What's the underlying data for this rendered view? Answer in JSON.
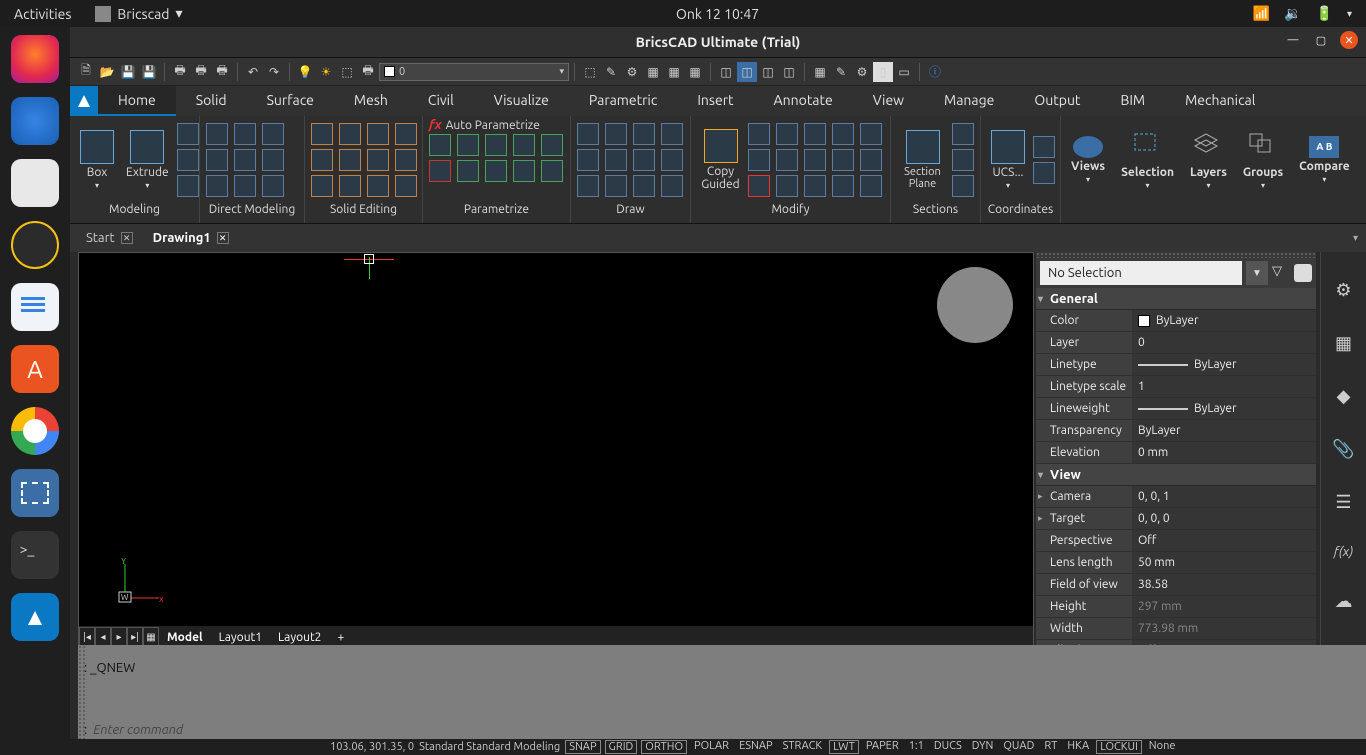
{
  "topbar": {
    "activities": "Activities",
    "app": "Bricscad",
    "datetime": "Onk 12  10:47"
  },
  "window": {
    "title": "BricsCAD Ultimate (Trial)"
  },
  "layer_combo": "0",
  "ribbon": {
    "tabs": [
      "Home",
      "Solid",
      "Surface",
      "Mesh",
      "Civil",
      "Visualize",
      "Parametric",
      "Insert",
      "Annotate",
      "View",
      "Manage",
      "Output",
      "BIM",
      "Mechanical"
    ],
    "active": "Home",
    "modeling": {
      "box": "Box",
      "extrude": "Extrude",
      "title": "Modeling"
    },
    "direct": {
      "title": "Direct Modeling"
    },
    "solidedit": {
      "title": "Solid Editing"
    },
    "parametrize": {
      "auto": "Auto Parametrize",
      "title": "Parametrize"
    },
    "draw": {
      "title": "Draw"
    },
    "modify": {
      "copy": "Copy Guided",
      "title": "Modify"
    },
    "sections": {
      "section": "Section Plane",
      "title": "Sections"
    },
    "coords": {
      "ucs": "UCS...",
      "title": "Coordinates"
    },
    "right": {
      "views": "Views",
      "selection": "Selection",
      "layers": "Layers",
      "groups": "Groups",
      "compare": "Compare"
    }
  },
  "doctabs": {
    "start": "Start",
    "drawing": "Drawing1"
  },
  "layout": {
    "model": "Model",
    "l1": "Layout1",
    "l2": "Layout2"
  },
  "cmd": {
    "hist": ":  _QNEW",
    "prompt": ":",
    "placeholder": "Enter command"
  },
  "status": {
    "coords": "103.06, 301.35, 0",
    "std": "Standard Standard Modeling",
    "toggles": [
      "SNAP",
      "GRID",
      "ORTHO",
      "POLAR",
      "ESNAP",
      "STRACK",
      "LWT",
      "PAPER",
      "1:1",
      "DUCS",
      "DYN",
      "QUAD",
      "RT",
      "HKA",
      "LOCKUI",
      "None"
    ]
  },
  "props": {
    "selection": "No Selection",
    "sections": [
      {
        "title": "General",
        "rows": [
          {
            "k": "Color",
            "v": "ByLayer",
            "swatch": true
          },
          {
            "k": "Layer",
            "v": "0"
          },
          {
            "k": "Linetype",
            "v": "ByLayer",
            "line": true
          },
          {
            "k": "Linetype scale",
            "v": "1"
          },
          {
            "k": "Lineweight",
            "v": "ByLayer",
            "line": true
          },
          {
            "k": "Transparency",
            "v": "ByLayer"
          },
          {
            "k": "Elevation",
            "v": "0 mm"
          }
        ]
      },
      {
        "title": "View",
        "rows": [
          {
            "k": "Camera",
            "v": "0, 0, 1",
            "exp": true
          },
          {
            "k": "Target",
            "v": "0, 0, 0",
            "exp": true
          },
          {
            "k": "Perspective",
            "v": "Off"
          },
          {
            "k": "Lens length",
            "v": "50 mm"
          },
          {
            "k": "Field of view",
            "v": "38.58"
          },
          {
            "k": "Height",
            "v": "297 mm",
            "dim": true
          },
          {
            "k": "Width",
            "v": "773.98 mm",
            "dim": true
          },
          {
            "k": "Clipping",
            "v": "Off",
            "dim": true
          }
        ]
      }
    ]
  }
}
